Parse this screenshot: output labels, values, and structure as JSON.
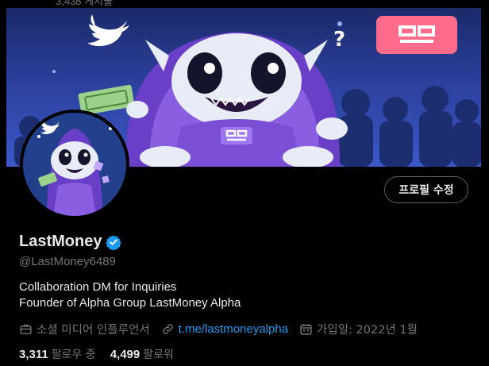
{
  "top": {
    "post_count": "3,438 게시물"
  },
  "profile": {
    "display_name": "LastMoney",
    "handle": "@LastMoney6489",
    "bio_lines": [
      "Collaboration DM for Inquiries",
      "Founder of Alpha Group LastMoney Alpha"
    ],
    "edit_label": "프로필 수정",
    "verified_color": "#1d9bf0",
    "banner_sign_color": "#ff6b8a"
  },
  "meta": {
    "category": "소셜 미디어 인플루언서",
    "link": "t.me/lastmoneyalpha",
    "joined": "가입일: 2022년 1월"
  },
  "stats": {
    "following_count": "3,311",
    "following_label": "팔로우 중",
    "followers_count": "4,499",
    "followers_label": "팔로워"
  }
}
